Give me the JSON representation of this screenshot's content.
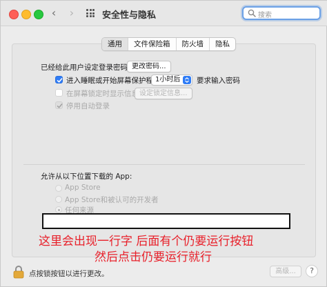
{
  "window": {
    "title": "安全性与隐私",
    "search_placeholder": "搜索",
    "nav_back": "‹",
    "nav_forward": "›"
  },
  "tabs": [
    "通用",
    "文件保险箱",
    "防火墙",
    "隐私"
  ],
  "general": {
    "password_set_label": "已经给此用户设定登录密码",
    "change_password_button": "更改密码...",
    "require_password_prefix": "进入睡眠或开始屏幕保护程序",
    "require_password_value": "1小时后",
    "require_password_suffix": "要求输入密码",
    "show_message_label": "在屏幕锁定时显示信息",
    "set_lock_message_button": "设定锁定信息...",
    "disable_auto_login_label": "停用自动登录"
  },
  "downloads": {
    "heading": "允许从以下位置下载的 App:",
    "options": [
      "App Store",
      "App Store和被认可的开发者",
      "任何来源"
    ]
  },
  "annotation": {
    "line1": "这里会出现一行字 后面有个仍要运行按钮",
    "line2": "然后点击仍要运行就行"
  },
  "footer": {
    "lock_text": "点按锁按钮以进行更改。",
    "advanced_button": "高级...",
    "help_button": "?"
  },
  "colors": {
    "accent": "#2f7cf6",
    "annotation": "#e8202a"
  }
}
